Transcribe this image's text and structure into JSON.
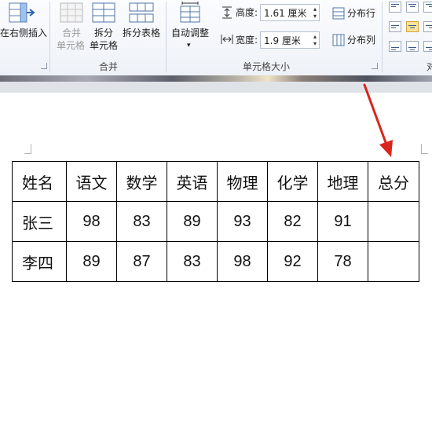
{
  "ribbon": {
    "insert_right_label": "在右侧插入",
    "merge_cells_line1": "合并",
    "merge_cells_line2": "单元格",
    "split_cells_line1": "拆分",
    "split_cells_line2": "单元格",
    "split_table_label": "拆分表格",
    "merge_group_label": "合并",
    "autofit_label": "自动调整",
    "height_label": "高度:",
    "height_value": "1.61 厘米",
    "width_label": "宽度:",
    "width_value": "1.9 厘米",
    "distribute_rows_label": "分布行",
    "distribute_cols_label": "分布列",
    "cell_size_group_label": "单元格大小",
    "alignment_group_partial": "对"
  },
  "table": {
    "headers": [
      "姓名",
      "语文",
      "数学",
      "英语",
      "物理",
      "化学",
      "地理",
      "总分"
    ],
    "rows": [
      [
        "张三",
        "98",
        "83",
        "89",
        "93",
        "82",
        "91",
        ""
      ],
      [
        "李四",
        "89",
        "87",
        "83",
        "98",
        "92",
        "78",
        ""
      ]
    ]
  },
  "colors": {
    "arrow": "#d9251c",
    "active_align": "#fbe39b"
  }
}
